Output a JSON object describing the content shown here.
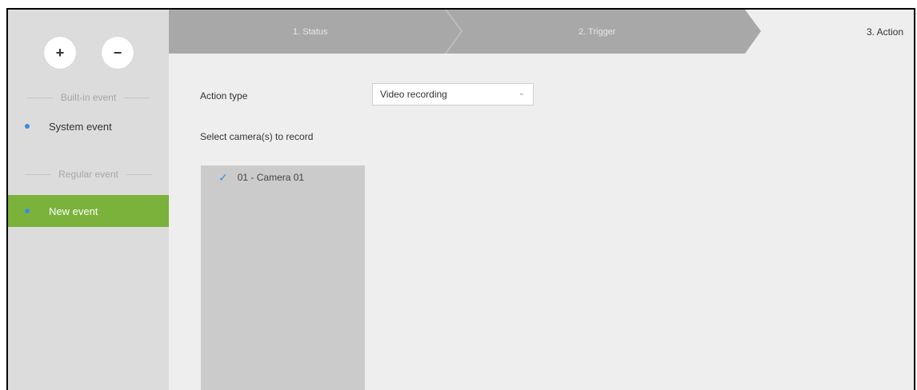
{
  "sidebar": {
    "add_label": "+",
    "remove_label": "−",
    "groups": [
      {
        "label": "Built-in event",
        "items": [
          {
            "label": "System event"
          }
        ]
      },
      {
        "label": "Regular event",
        "items": [
          {
            "label": "New event"
          }
        ]
      }
    ]
  },
  "steps": [
    {
      "label": "1. Status"
    },
    {
      "label": "2. Trigger"
    },
    {
      "label": "3. Action"
    }
  ],
  "form": {
    "action_type_label": "Action type",
    "action_type_value": "Video recording",
    "select_cameras_label": "Select camera(s) to record",
    "cameras": [
      {
        "label": "01 - Camera 01",
        "checked": true
      }
    ]
  },
  "colors": {
    "active": "#7ab23b",
    "accent": "#3a8be0"
  },
  "icons": {
    "check": "check-icon",
    "dropdown": "chevron-down-icon"
  }
}
